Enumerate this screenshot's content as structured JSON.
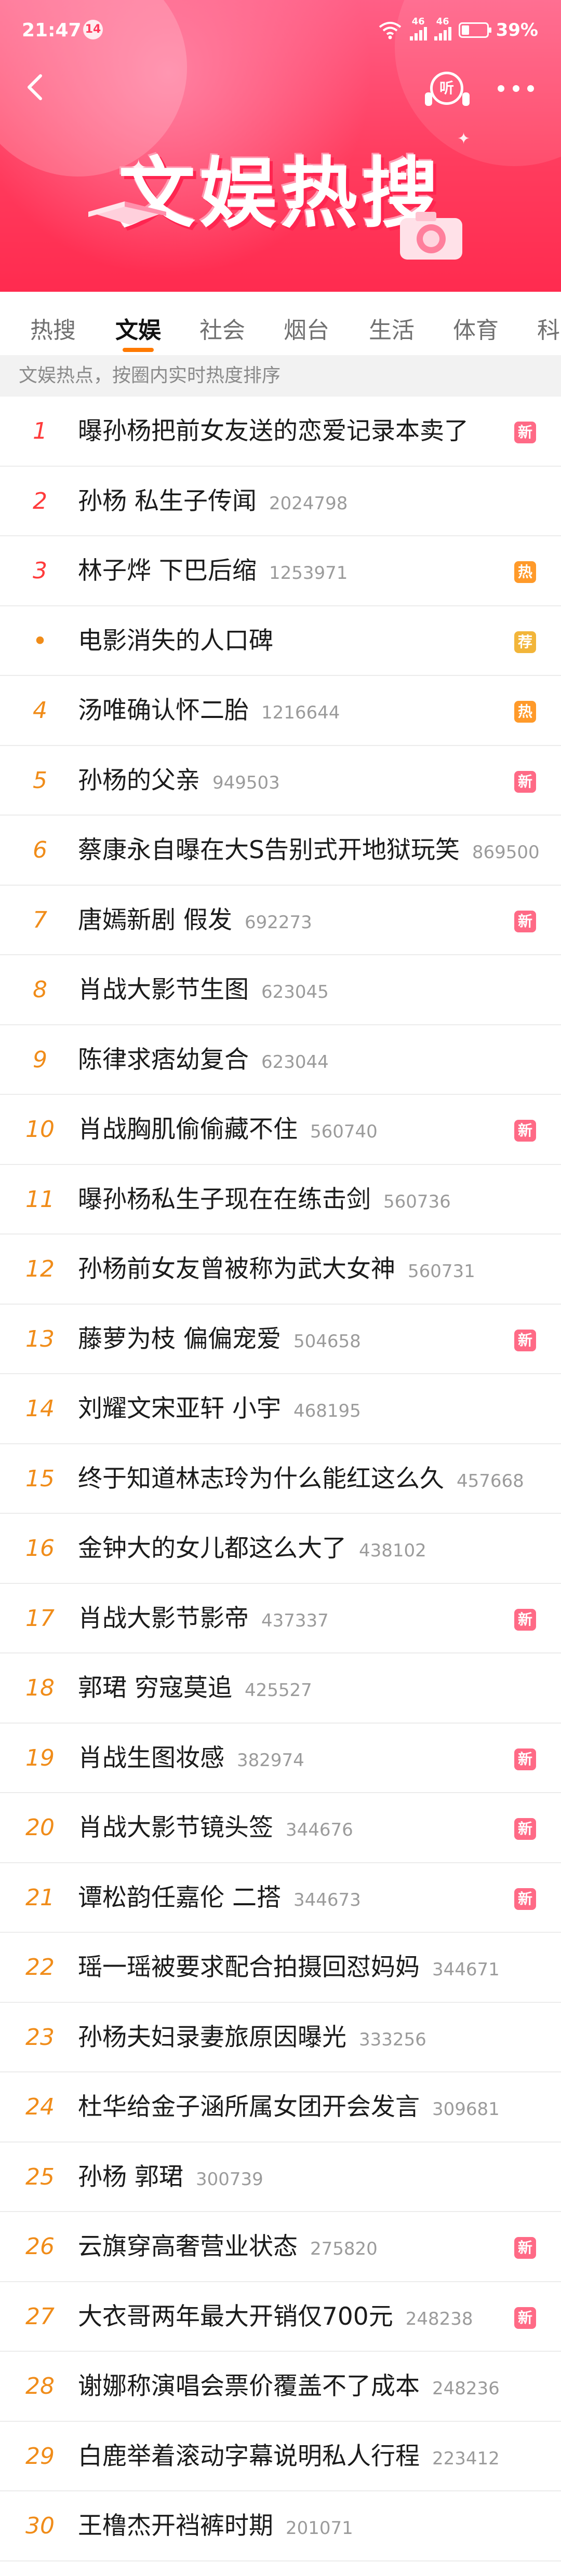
{
  "status": {
    "time": "21:47",
    "notif_count": "14",
    "battery": "39%",
    "sim1": "46",
    "sim2": "46"
  },
  "header": {
    "banner": "文娱热搜",
    "listen_label": "听"
  },
  "tabs": [
    "热搜",
    "文娱",
    "社会",
    "烟台",
    "生活",
    "体育",
    "科"
  ],
  "active_tab": "文娱",
  "subtitle": "文娱热点，按圈内实时热度排序",
  "badges": {
    "new": "新",
    "hot": "热",
    "rec": "荐"
  },
  "colors": {
    "accent": "#ff7a00",
    "rank_top": "#ff3b3b",
    "rank_other": "#f08c19",
    "badge_new": "#ff6a86",
    "badge_hot": "#ff9a2a",
    "badge_rec": "#f2b53a"
  },
  "items": [
    {
      "rank": "1",
      "title": "曝孙杨把前女友送的恋爱记录本卖了",
      "heat": "",
      "badge": "新"
    },
    {
      "rank": "2",
      "title": "孙杨 私生子传闻",
      "heat": "2024798",
      "badge": ""
    },
    {
      "rank": "3",
      "title": "林子烨 下巴后缩",
      "heat": "1253971",
      "badge": "热"
    },
    {
      "rank": "•",
      "title": "电影消失的人口碑",
      "heat": "",
      "badge": "荐"
    },
    {
      "rank": "4",
      "title": "汤唯确认怀二胎",
      "heat": "1216644",
      "badge": "热"
    },
    {
      "rank": "5",
      "title": "孙杨的父亲",
      "heat": "949503",
      "badge": "新"
    },
    {
      "rank": "6",
      "title": "蔡康永自曝在大S告别式开地狱玩笑",
      "heat": "869500",
      "badge": ""
    },
    {
      "rank": "7",
      "title": "唐嫣新剧 假发",
      "heat": "692273",
      "badge": "新"
    },
    {
      "rank": "8",
      "title": "肖战大影节生图",
      "heat": "623045",
      "badge": ""
    },
    {
      "rank": "9",
      "title": "陈律求痞幼复合",
      "heat": "623044",
      "badge": ""
    },
    {
      "rank": "10",
      "title": "肖战胸肌偷偷藏不住",
      "heat": "560740",
      "badge": "新"
    },
    {
      "rank": "11",
      "title": "曝孙杨私生子现在在练击剑",
      "heat": "560736",
      "badge": ""
    },
    {
      "rank": "12",
      "title": "孙杨前女友曾被称为武大女神",
      "heat": "560731",
      "badge": ""
    },
    {
      "rank": "13",
      "title": "藤萝为枝 偏偏宠爱",
      "heat": "504658",
      "badge": "新"
    },
    {
      "rank": "14",
      "title": "刘耀文宋亚轩 小宇",
      "heat": "468195",
      "badge": ""
    },
    {
      "rank": "15",
      "title": "终于知道林志玲为什么能红这么久",
      "heat": "457668",
      "badge": ""
    },
    {
      "rank": "16",
      "title": "金钟大的女儿都这么大了",
      "heat": "438102",
      "badge": ""
    },
    {
      "rank": "17",
      "title": "肖战大影节影帝",
      "heat": "437337",
      "badge": "新"
    },
    {
      "rank": "18",
      "title": "郭珺 穷寇莫追",
      "heat": "425527",
      "badge": ""
    },
    {
      "rank": "19",
      "title": "肖战生图妆感",
      "heat": "382974",
      "badge": "新"
    },
    {
      "rank": "20",
      "title": "肖战大影节镜头签",
      "heat": "344676",
      "badge": "新"
    },
    {
      "rank": "21",
      "title": "谭松韵任嘉伦 二搭",
      "heat": "344673",
      "badge": "新"
    },
    {
      "rank": "22",
      "title": "瑶一瑶被要求配合拍摄回怼妈妈",
      "heat": "344671",
      "badge": ""
    },
    {
      "rank": "23",
      "title": "孙杨夫妇录妻旅原因曝光",
      "heat": "333256",
      "badge": ""
    },
    {
      "rank": "24",
      "title": "杜华给金子涵所属女团开会发言",
      "heat": "309681",
      "badge": ""
    },
    {
      "rank": "25",
      "title": "孙杨 郭珺",
      "heat": "300739",
      "badge": ""
    },
    {
      "rank": "26",
      "title": "云旗穿高奢营业状态",
      "heat": "275820",
      "badge": "新"
    },
    {
      "rank": "27",
      "title": "大衣哥两年最大开销仅700元",
      "heat": "248238",
      "badge": "新"
    },
    {
      "rank": "28",
      "title": "谢娜称演唱会票价覆盖不了成本",
      "heat": "248236",
      "badge": ""
    },
    {
      "rank": "29",
      "title": "白鹿举着滚动字幕说明私人行程",
      "heat": "223412",
      "badge": ""
    },
    {
      "rank": "30",
      "title": "王橹杰开裆裤时期",
      "heat": "201071",
      "badge": ""
    }
  ]
}
